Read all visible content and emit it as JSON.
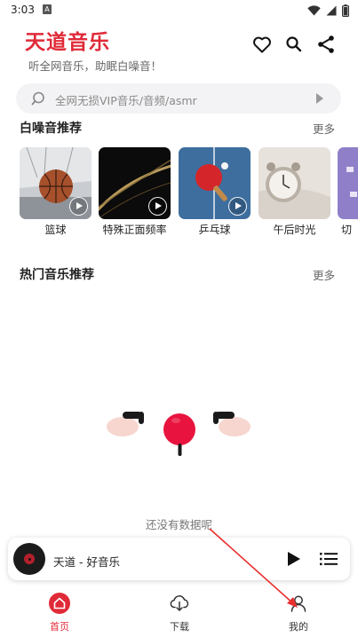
{
  "status_bar": {
    "time": "3:03",
    "notification_glyph": "A",
    "icons": [
      "wifi-icon",
      "signal-icon",
      "battery-icon"
    ]
  },
  "header": {
    "title": "天道音乐",
    "subtitle": "听全网音乐，助眠白噪音！",
    "actions": [
      "favorite-heart-icon",
      "search-icon",
      "share-icon"
    ]
  },
  "search": {
    "placeholder": "全网无损VIP音乐/音频/asmr"
  },
  "white_noise_section": {
    "title": "白噪音推荐",
    "more": "更多",
    "items": [
      {
        "label": "篮球",
        "thumb": "basketball"
      },
      {
        "label": "特殊正面频率",
        "thumb": "light-streak"
      },
      {
        "label": "乒乓球",
        "thumb": "ping-pong"
      },
      {
        "label": "午后时光",
        "thumb": "alarm-clock"
      },
      {
        "label": "切",
        "thumb": "purple-partial"
      }
    ]
  },
  "hot_music_section": {
    "title": "热门音乐推荐",
    "more": "更多",
    "empty_text": "还没有数据呢"
  },
  "player": {
    "title": "天道 - 好音乐"
  },
  "bottom_nav": {
    "items": [
      {
        "label": "首页",
        "icon": "home-icon",
        "active": true
      },
      {
        "label": "下载",
        "icon": "cloud-download-icon",
        "active": false
      },
      {
        "label": "我的",
        "icon": "user-icon",
        "active": false
      }
    ]
  },
  "colors": {
    "brand": "#e02a38",
    "annotation_arrow": "#e8302f"
  }
}
